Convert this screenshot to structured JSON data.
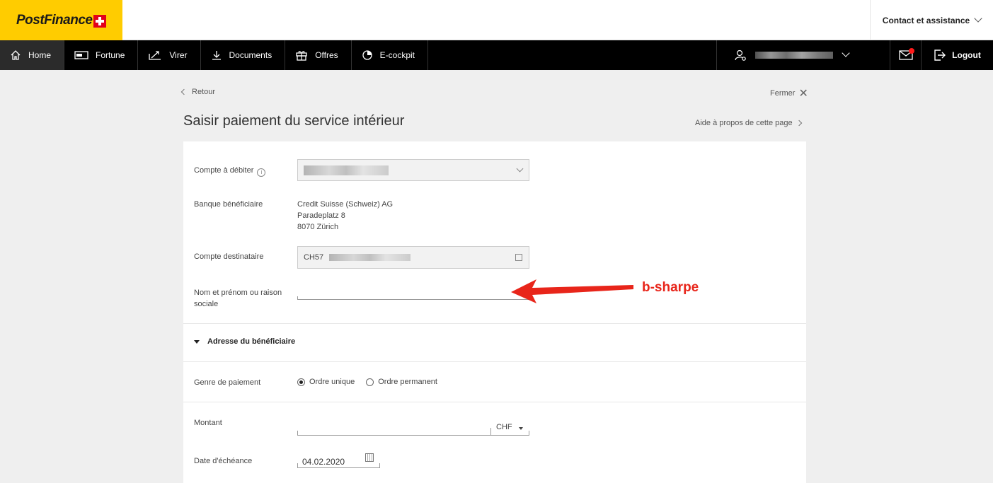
{
  "header": {
    "logo_text": "PostFinance",
    "contact_label": "Contact et assistance"
  },
  "nav": {
    "items": [
      {
        "label": "Home",
        "icon": "home-icon"
      },
      {
        "label": "Fortune",
        "icon": "chf-card-icon"
      },
      {
        "label": "Virer",
        "icon": "transfer-icon"
      },
      {
        "label": "Documents",
        "icon": "download-icon"
      },
      {
        "label": "Offres",
        "icon": "gift-icon"
      },
      {
        "label": "E-cockpit",
        "icon": "pie-chart-icon"
      }
    ],
    "logout_label": "Logout"
  },
  "page": {
    "back_label": "Retour",
    "close_label": "Fermer",
    "title": "Saisir paiement du service intérieur",
    "help_label": "Aide à propos de cette page"
  },
  "form": {
    "debit_label": "Compte à débiter",
    "bank_label": "Banque bénéficiaire",
    "bank_lines": [
      "Credit Suisse (Schweiz) AG",
      "Paradeplatz 8",
      "8070 Zürich"
    ],
    "dest_label": "Compte destinataire",
    "dest_prefix": "CH57",
    "name_label": "Nom et prénom ou raison sociale",
    "address_section": "Adresse du bénéficiaire",
    "payment_type_label": "Genre de paiement",
    "payment_options": [
      {
        "label": "Ordre unique",
        "checked": true
      },
      {
        "label": "Ordre permanent",
        "checked": false
      }
    ],
    "amount_label": "Montant",
    "currency": "CHF",
    "due_date_label": "Date d'échéance",
    "due_date_value": "04.02.2020"
  },
  "annotation": {
    "text": "b-sharpe",
    "color": "#e8251a"
  },
  "colors": {
    "brand_yellow": "#ffcc00",
    "brand_red": "#e2001a",
    "nav_bg": "#000000"
  }
}
